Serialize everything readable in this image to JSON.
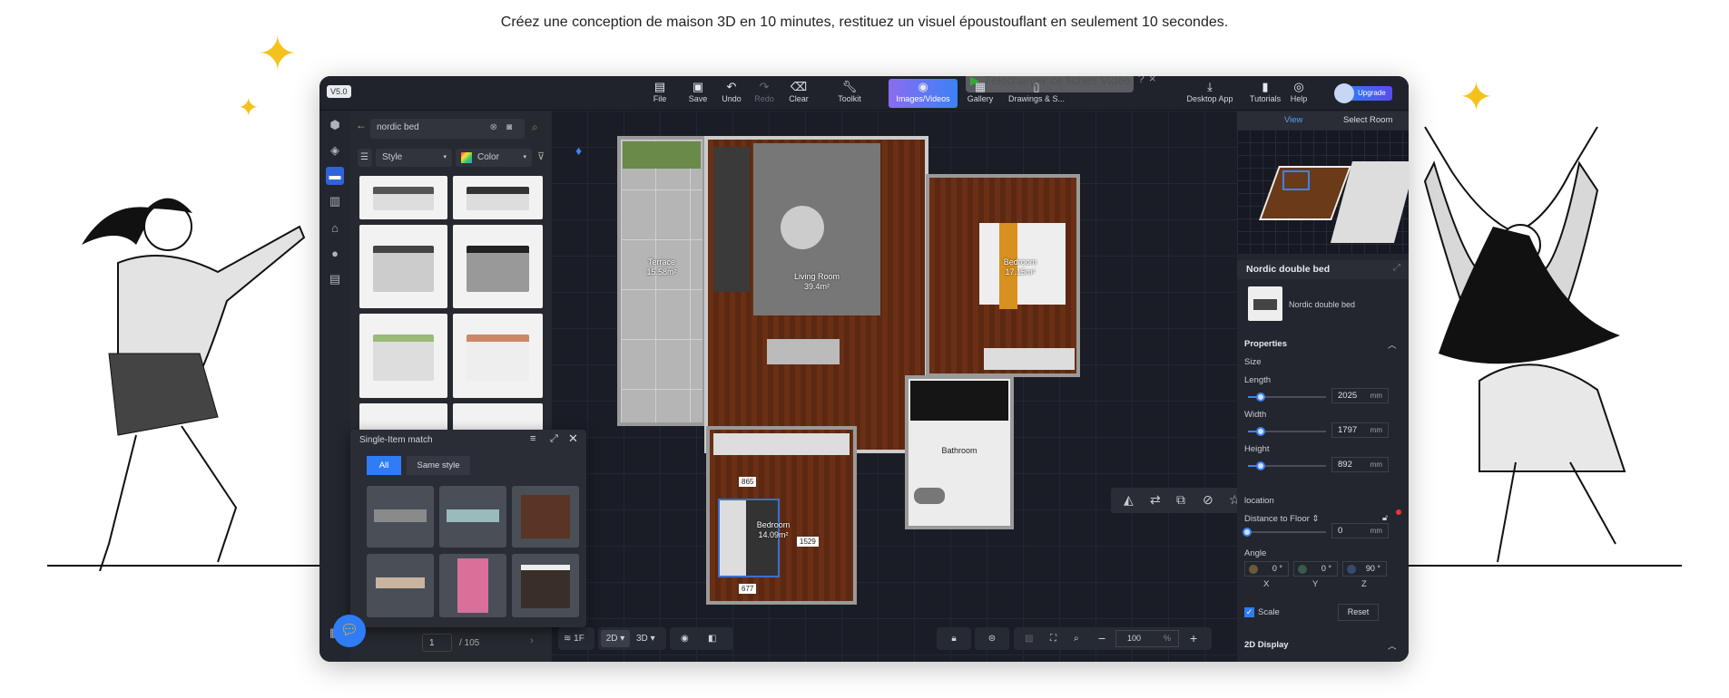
{
  "headline": "Créez une conception de maison 3D en 10 minutes, restituez un visuel époustouflant en seulement 10 secondes.",
  "overlay": {
    "download_label": "Télécharger ce fichier Vidéo",
    "help": "?",
    "close": "×"
  },
  "app": {
    "version": "V5.0",
    "toolbar": [
      {
        "label": "File",
        "icon": "file-icon"
      },
      {
        "label": "Save",
        "icon": "save-icon"
      },
      {
        "label": "Undo",
        "icon": "undo-icon"
      },
      {
        "label": "Redo",
        "icon": "redo-icon",
        "disabled": true
      },
      {
        "label": "Clear",
        "icon": "eraser-icon"
      },
      {
        "label": "Toolkit",
        "icon": "wrench-icon"
      },
      {
        "label": "Images/Videos",
        "icon": "camera-icon",
        "active": true
      },
      {
        "label": "Gallery",
        "icon": "gallery-icon"
      },
      {
        "label": "Drawings & S...",
        "icon": "drawing-icon"
      }
    ],
    "toolbar_right": [
      {
        "label": "Desktop App",
        "icon": "download-icon"
      },
      {
        "label": "Tutorials",
        "icon": "book-icon"
      },
      {
        "label": "Help",
        "icon": "help-icon"
      }
    ],
    "upgrade_label": "Upgrade",
    "library": {
      "search_value": "nordic bed",
      "style_label": "Style",
      "color_label": "Color"
    },
    "match_panel": {
      "title": "Single-Item match",
      "tabs": [
        "All",
        "Same style"
      ],
      "active_tab": "All"
    },
    "pagination": {
      "page": "1",
      "total": "/ 105"
    },
    "rooms": {
      "terrace": {
        "name": "Terrace",
        "area": "15.58m²"
      },
      "living": {
        "name": "Living Room",
        "area": "39.4m²"
      },
      "bedroom1": {
        "name": "Bedroom",
        "area": "17.15m²"
      },
      "bathroom": {
        "name": "Bathroom"
      },
      "bedroom2": {
        "name": "Bedroom",
        "area": "14.09m²"
      }
    },
    "dimensions": {
      "top": "865",
      "right": "1529",
      "bottom": "677"
    },
    "bottom_bar": {
      "floor": "1F",
      "view2d": "2D",
      "view3d": "3D",
      "zoom": "100",
      "zoom_unit": "%"
    },
    "right_panel": {
      "tabs": [
        "View",
        "Select Room"
      ],
      "active_tab": "View",
      "item_title": "Nordic double bed",
      "item_name": "Nordic double bed",
      "properties_label": "Properties",
      "size_label": "Size",
      "length": {
        "label": "Length",
        "value": "2025",
        "unit": "mm"
      },
      "width": {
        "label": "Width",
        "value": "1797",
        "unit": "mm"
      },
      "height": {
        "label": "Height",
        "value": "892",
        "unit": "mm"
      },
      "location_label": "location",
      "distance": {
        "label": "Distance to Floor ⇕",
        "value": "0",
        "unit": "mm"
      },
      "angle_label": "Angle",
      "angles": {
        "x": "0 °",
        "y": "0 °",
        "z": "90 °"
      },
      "axes": [
        "X",
        "Y",
        "Z"
      ],
      "scale_label": "Scale",
      "scale_checked": true,
      "reset_label": "Reset",
      "display_label": "2D Display"
    },
    "colors": {
      "accent": "#3b82f6",
      "active_gradient": "#8b6cf0"
    }
  }
}
